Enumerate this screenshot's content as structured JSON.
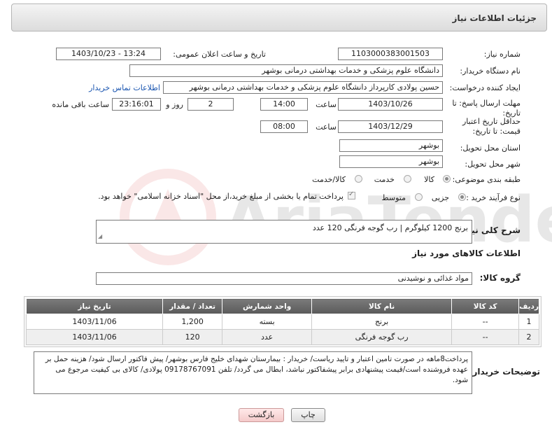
{
  "header": {
    "title": "جزئیات اطلاعات نیاز"
  },
  "fields": {
    "need_number": {
      "label": "شماره نیاز:",
      "value": "1103000383001503"
    },
    "announce_datetime": {
      "label": "تاریخ و ساعت اعلان عمومی:",
      "value": "1403/10/23 - 13:24"
    },
    "buyer_org": {
      "label": "نام دستگاه خریدار:",
      "value": "دانشگاه علوم پزشکی و خدمات بهداشتی درمانی بوشهر"
    },
    "requester": {
      "label": "ایجاد کننده درخواست:",
      "value": "حسین پولادی کارپرداز دانشگاه علوم پزشکی و خدمات بهداشتی درمانی بوشهر",
      "contact_link": "اطلاعات تماس خریدار"
    },
    "reply_deadline": {
      "label": "مهلت ارسال پاسخ: تا تاریخ:",
      "date": "1403/10/26",
      "time_label": "ساعت",
      "time": "14:00",
      "days": "2",
      "days_label": "روز و",
      "remaining": "23:16:01",
      "remaining_label": "ساعت باقی مانده"
    },
    "price_validity": {
      "label": "حداقل تاریخ اعتبار قیمت: تا تاریخ:",
      "date": "1403/12/29",
      "time_label": "ساعت",
      "time": "08:00"
    },
    "province": {
      "label": "استان محل تحویل:",
      "value": "بوشهر"
    },
    "city": {
      "label": "شهر محل تحویل:",
      "value": "بوشهر"
    },
    "category": {
      "label": "طبقه بندی موضوعی:",
      "options": [
        "کالا",
        "خدمت",
        "کالا/خدمت"
      ],
      "selected": "کالا"
    },
    "purchase_process": {
      "label": "نوع فرآیند خرید :",
      "options": [
        "جزیی",
        "متوسط"
      ],
      "note": "پرداخت تمام یا بخشی از مبلغ خرید،از محل \"اسناد خزانه اسلامی\" خواهد بود."
    }
  },
  "summary": {
    "label": "شرح کلی نیاز:",
    "value": "برنج 1200 کیلوگرم | رب گوجه فرنگی 120 عدد"
  },
  "goods_info": {
    "title": "اطلاعات کالاهای مورد نیاز"
  },
  "goods_group": {
    "label": "گروه کالا:",
    "value": "مواد غذائی و نوشیدنی"
  },
  "table": {
    "columns": [
      "ردیف",
      "کد کالا",
      "نام کالا",
      "واحد شمارش",
      "تعداد / مقدار",
      "تاریخ نیاز"
    ],
    "rows": [
      [
        "1",
        "--",
        "برنج",
        "بسته",
        "1,200",
        "1403/11/06"
      ],
      [
        "2",
        "--",
        "رب گوجه فرنگی",
        "عدد",
        "120",
        "1403/11/06"
      ]
    ]
  },
  "buyer_notes": {
    "label": "توضیحات خریدار:",
    "value": "پرداخت8ماهه در صورت تامین اعتبار و تایید ریاست/ خریدار : بیمارستان شهدای خلیج فارس بوشهر/ پیش فاکتور ارسال شود/ هزینه حمل بر عهده فروشنده است/قیمت پیشنهادی برابر پیشفاکتور نباشد، ابطال می گردد/ تلفن 09178767091 پولادی/ کالای بی کیفیت مرجوع می شود."
  },
  "buttons": {
    "print": "چاپ",
    "back": "بازگشت"
  },
  "watermark": {
    "text": "AriaTender.net"
  }
}
